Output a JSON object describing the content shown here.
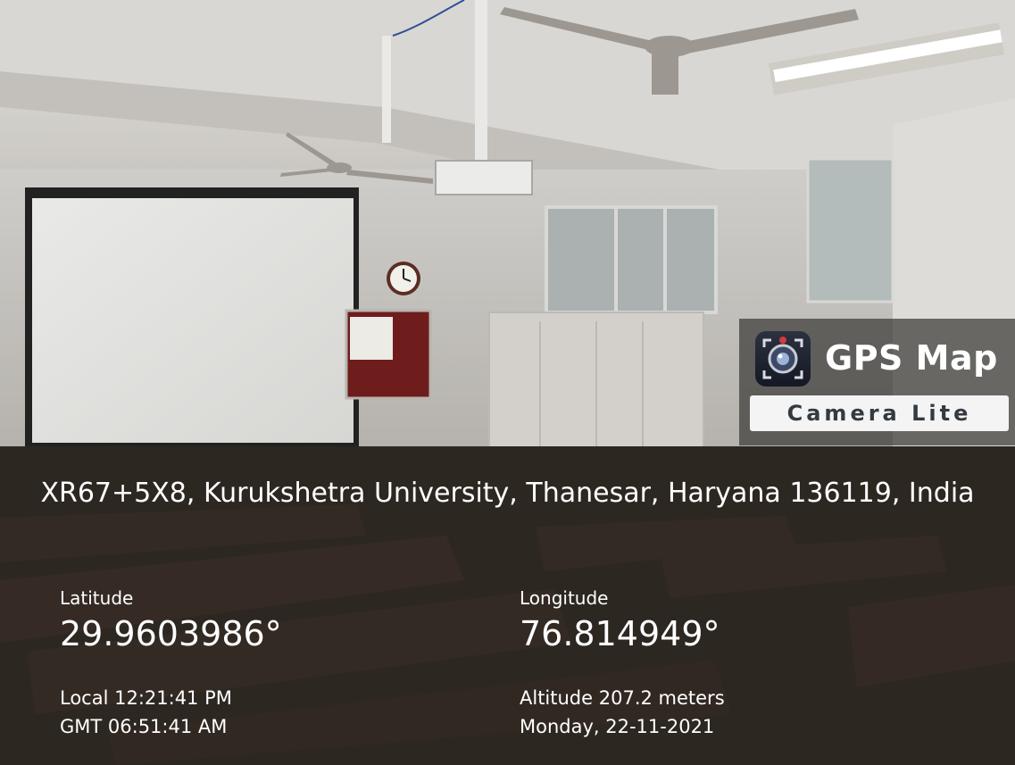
{
  "badge": {
    "title": "GPS Map",
    "subtitle": "Camera Lite",
    "icon": "camera-lens-icon"
  },
  "location": {
    "address": "XR67+5X8, Kurukshetra University, Thanesar, Haryana 136119, India",
    "latitude_label": "Latitude",
    "latitude_value": "29.9603986°",
    "longitude_label": "Longitude",
    "longitude_value": "76.814949°",
    "local_time": "Local 12:21:41 PM",
    "gmt_time": "GMT 06:51:41 AM",
    "altitude": "Altitude 207.2 meters",
    "date": "Monday, 22-11-2021"
  },
  "colors": {
    "overlay": "#121212",
    "text": "#ffffff",
    "badge_bg": "#3c3a38"
  }
}
